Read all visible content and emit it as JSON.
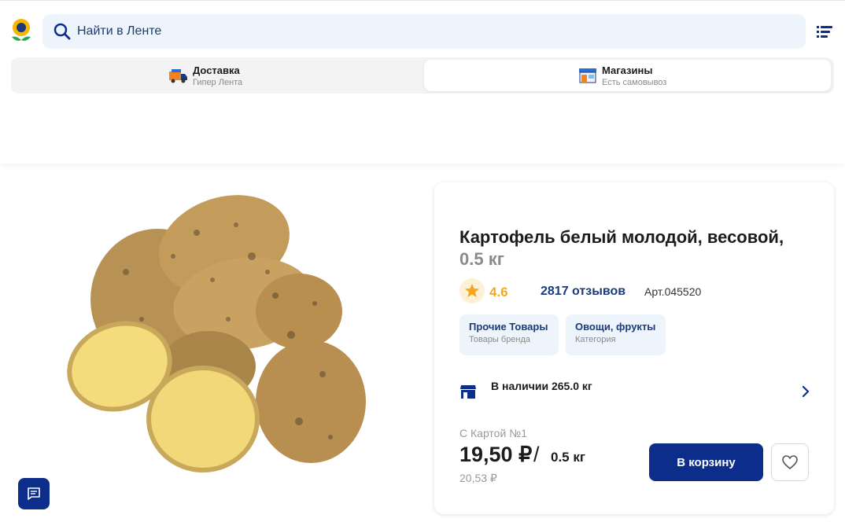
{
  "search": {
    "placeholder": "Найти в Ленте"
  },
  "mode_tabs": [
    {
      "title": "Доставка",
      "subtitle": "Гипер Лента",
      "icon": "truck-icon"
    },
    {
      "title": "Магазины",
      "subtitle": "Есть самовывоз",
      "icon": "store-icon",
      "selected": true
    }
  ],
  "product": {
    "title": "Картофель белый молодой, весовой,",
    "weight": "0.5 кг",
    "rating": "4.6",
    "reviews": "2817 отзывов",
    "article": "Арт.045520",
    "chips": [
      {
        "title": "Прочие Товары",
        "subtitle": "Товары бренда"
      },
      {
        "title": "Овощи, фрукты",
        "subtitle": "Категория"
      }
    ],
    "stock": "В наличии 265.0 кг",
    "price_label": "С Картой №1",
    "price": "19,50 ₽",
    "price_sep": "/",
    "price_unit": "0.5 кг",
    "old_price": "20,53 ₽",
    "cart_label": "В корзину"
  },
  "colors": {
    "brand_blue": "#0c2e8a",
    "rating_orange": "#f5a623",
    "search_bg": "#eef4fc"
  },
  "icons": [
    "lenta-logo",
    "search-icon",
    "filter-list-icon",
    "truck-icon",
    "store-icon",
    "star-icon",
    "store-front-icon",
    "chevron-right-icon",
    "heart-icon",
    "chat-icon"
  ]
}
